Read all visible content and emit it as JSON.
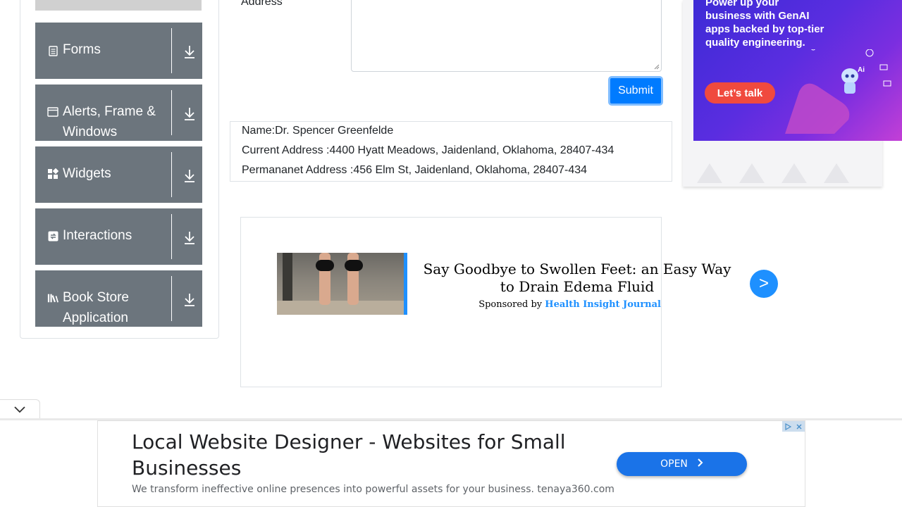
{
  "sidebar": {
    "groups": [
      {
        "label": "Forms",
        "icon": "form-icon"
      },
      {
        "label": "Alerts, Frame & Windows",
        "icon": "window-icon"
      },
      {
        "label": "Widgets",
        "icon": "widgets-icon"
      },
      {
        "label": "Interactions",
        "icon": "interactions-icon"
      },
      {
        "label": "Book Store Application",
        "icon": "books-icon"
      }
    ]
  },
  "form": {
    "address_label": "Address",
    "submit_label": "Submit"
  },
  "output": {
    "name": "Name:Dr. Spencer Greenfelde",
    "current_address": "Current Address :4400 Hyatt Meadows, Jaidenland, Oklahoma, 28407-434",
    "permanent_address": "Permananet Address :456 Elm St, Jaidenland, Oklahoma, 28407-434"
  },
  "native_ad": {
    "title": "Say Goodbye to Swollen Feet: an Easy Way to Drain Edema Fluid",
    "sponsored_prefix": "Sponsored by",
    "sponsor": "Health Insight Journal",
    "arrow": ">"
  },
  "right_banner": {
    "text": "Power up your business with GenAI apps backed by top-tier quality engineering.",
    "cta": "Let’s talk",
    "badge": "Ai"
  },
  "bottom_ad": {
    "title": "Local Website Designer - Websites for Small Businesses",
    "description": "We transform ineffective online presences into powerful assets for your business. tenaya360.com",
    "open_label": "OPEN"
  }
}
